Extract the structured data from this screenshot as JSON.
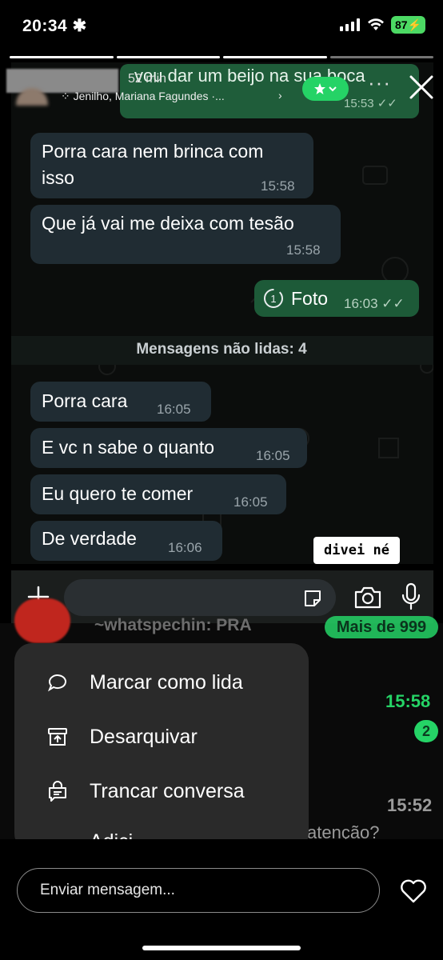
{
  "status_bar": {
    "time": "20:34",
    "battery": "87"
  },
  "story": {
    "elapsed": "52 min",
    "names": "Jenilho, Mariana Fagundes ·...",
    "chevron": "›",
    "more": "···"
  },
  "chat": {
    "reply": {
      "text": "vou dar um beijo na sua boca",
      "time": "15:53"
    },
    "messages": [
      {
        "text": "Porra cara nem brinca com",
        "text2": "isso",
        "time": "15:58"
      },
      {
        "text": "Que já vai me deixa com tesão",
        "time": "15:58"
      },
      {
        "text": "Foto",
        "time": "16:03",
        "outgoing": true
      },
      {
        "text": "Porra cara",
        "time": "16:05"
      },
      {
        "text": "E vc n sabe o quanto",
        "time": "16:05"
      },
      {
        "text": "Eu quero te comer",
        "time": "16:05"
      },
      {
        "text": "De verdade",
        "time": "16:06"
      }
    ],
    "unread_divider": "Mensagens não lidas: 4",
    "sticker_text": "divei né",
    "view_once_digit": "1"
  },
  "background_list": {
    "name1": "~whatspechin: PRA",
    "badge1": "Mais de 999",
    "time1": "15:58",
    "badge2": "2",
    "time2": "15:52",
    "preview": "atenção?"
  },
  "context_menu": {
    "items": [
      {
        "label": "Marcar como lida",
        "icon": "chat-bubble-icon"
      },
      {
        "label": "Desarquivar",
        "icon": "unarchive-icon"
      },
      {
        "label": "Trancar conversa",
        "icon": "lock-chat-icon"
      },
      {
        "label": "Adici...",
        "icon": "add-icon"
      }
    ]
  },
  "reply_bar": {
    "placeholder": "Enviar mensagem..."
  },
  "colors": {
    "accent": "#25d366",
    "bubble_out": "#1d5a38",
    "bubble_in": "#202c33"
  }
}
